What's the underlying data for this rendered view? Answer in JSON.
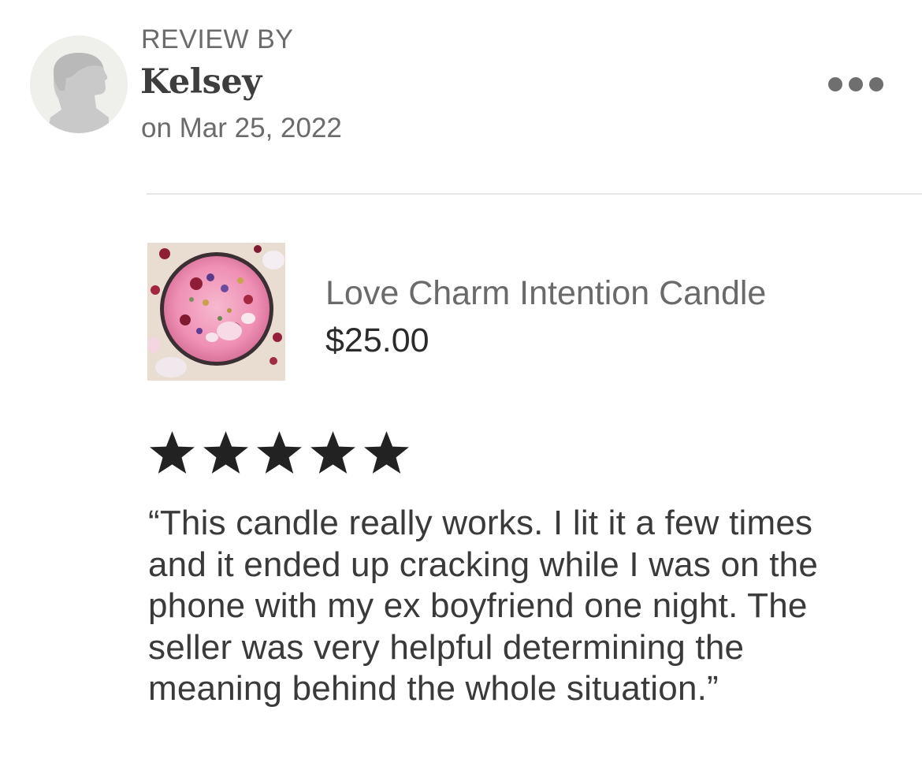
{
  "review": {
    "label": "REVIEW BY",
    "reviewer_name": "Kelsey",
    "date": "on Mar 25, 2022",
    "rating": 5,
    "rating_max": 5,
    "text": "“This candle really works. I lit it a few times and it ended up cracking while I was on the phone with my ex boyfriend one night. The seller was very helpful determining the meaning behind the whole situation.”"
  },
  "product": {
    "title": "Love Charm Intention Candle",
    "price": "$25.00"
  },
  "icons": {
    "avatar": "default-user-silhouette-icon",
    "more": "more-horizontal-icon",
    "star": "star-filled-icon"
  },
  "colors": {
    "star": "#222222",
    "avatar_bg": "#efefec",
    "avatar_figure": "#c9c9c9",
    "muted_text": "#6b6b6b",
    "divider": "#e6e6e6"
  }
}
